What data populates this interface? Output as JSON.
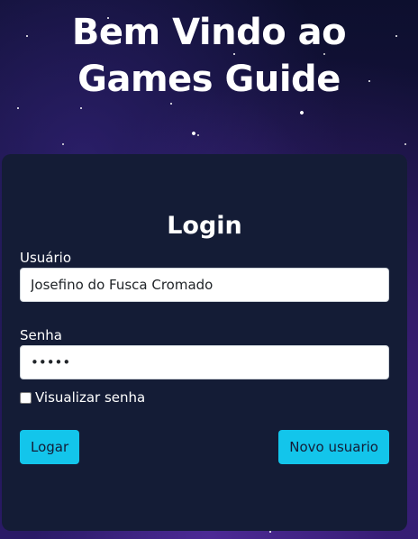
{
  "page": {
    "title": "Bem Vindo ao Games Guide"
  },
  "login_form": {
    "heading": "Login",
    "username_label": "Usuário",
    "username_value": "Josefino do Fusca Cromado",
    "password_label": "Senha",
    "password_value": "•••••",
    "show_password_label": "Visualizar senha",
    "show_password_checked": false,
    "login_button_label": "Logar",
    "new_user_button_label": "Novo usuario"
  },
  "colors": {
    "card_background": "#141c36",
    "button_accent": "#13c5eb",
    "text": "#ffffff"
  }
}
